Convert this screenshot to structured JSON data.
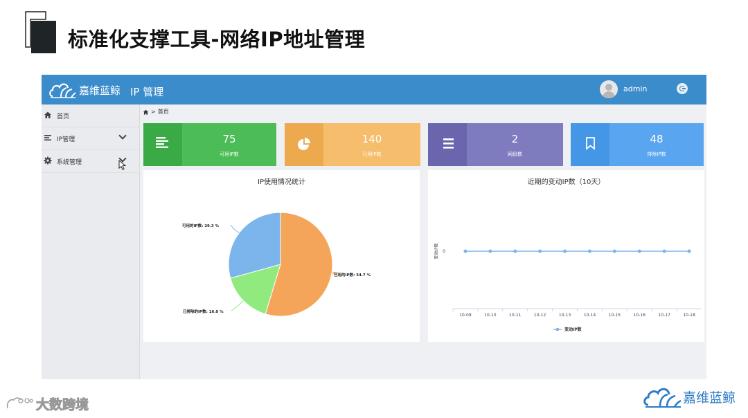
{
  "slide": {
    "title": "标准化支撑工具-网络IP地址管理"
  },
  "app": {
    "brand_name": "嘉维蓝鲸",
    "page_name": "IP 管理",
    "user": {
      "name": "admin"
    },
    "sidebar": {
      "items": [
        {
          "label": "首页",
          "icon": "home-icon"
        },
        {
          "label": "IP管理",
          "icon": "list-icon",
          "expandable": true
        },
        {
          "label": "系统管理",
          "icon": "gear-icon",
          "expandable": true
        }
      ]
    },
    "breadcrumb": {
      "current": "首页",
      "separator": ">"
    },
    "stats": [
      {
        "value": "75",
        "label": "可用IP数",
        "icon": "bars-icon",
        "color": "#4cbc57",
        "icon_bg": "#3aaa46"
      },
      {
        "value": "140",
        "label": "已用IP数",
        "icon": "pie-icon",
        "color": "#f5bd6c",
        "icon_bg": "#eda94e"
      },
      {
        "value": "2",
        "label": "网段数",
        "icon": "menu-icon",
        "color": "#7f7bbf",
        "icon_bg": "#6a66ad"
      },
      {
        "value": "48",
        "label": "排除IP数",
        "icon": "bookmark-icon",
        "color": "#5aa5ef",
        "icon_bg": "#4496e6"
      }
    ],
    "pie_panel": {
      "title": "IP使用情况统计"
    },
    "line_panel": {
      "title": "近期的变动IP数（10天）"
    }
  },
  "footer": {
    "left_logo": "大数跨境",
    "right_logo": "嘉维蓝鲸"
  },
  "chart_data": [
    {
      "type": "pie",
      "title": "IP使用情况统计",
      "slices": [
        {
          "label": "已用的IP数: 54.7 %",
          "value": 54.7,
          "color": "#f5a55a"
        },
        {
          "label": "已排除的IP数: 16.0 %",
          "value": 16.0,
          "color": "#90ea7e"
        },
        {
          "label": "可用的IP数: 29.3 %",
          "value": 29.3,
          "color": "#7cb5ec"
        }
      ]
    },
    {
      "type": "line",
      "title": "近期的变动IP数（10天）",
      "x": [
        "10-09",
        "10-10",
        "10-11",
        "10-12",
        "10-13",
        "10-14",
        "10-15",
        "10-16",
        "10-17",
        "10-18"
      ],
      "series": [
        {
          "name": "变动IP数",
          "values": [
            0,
            0,
            0,
            0,
            0,
            0,
            0,
            0,
            0,
            0
          ],
          "color": "#7cb5ec"
        }
      ],
      "ylabel": "变动IP数",
      "yticks": [
        "0"
      ],
      "legend": "bottom-center",
      "grid": false
    }
  ]
}
